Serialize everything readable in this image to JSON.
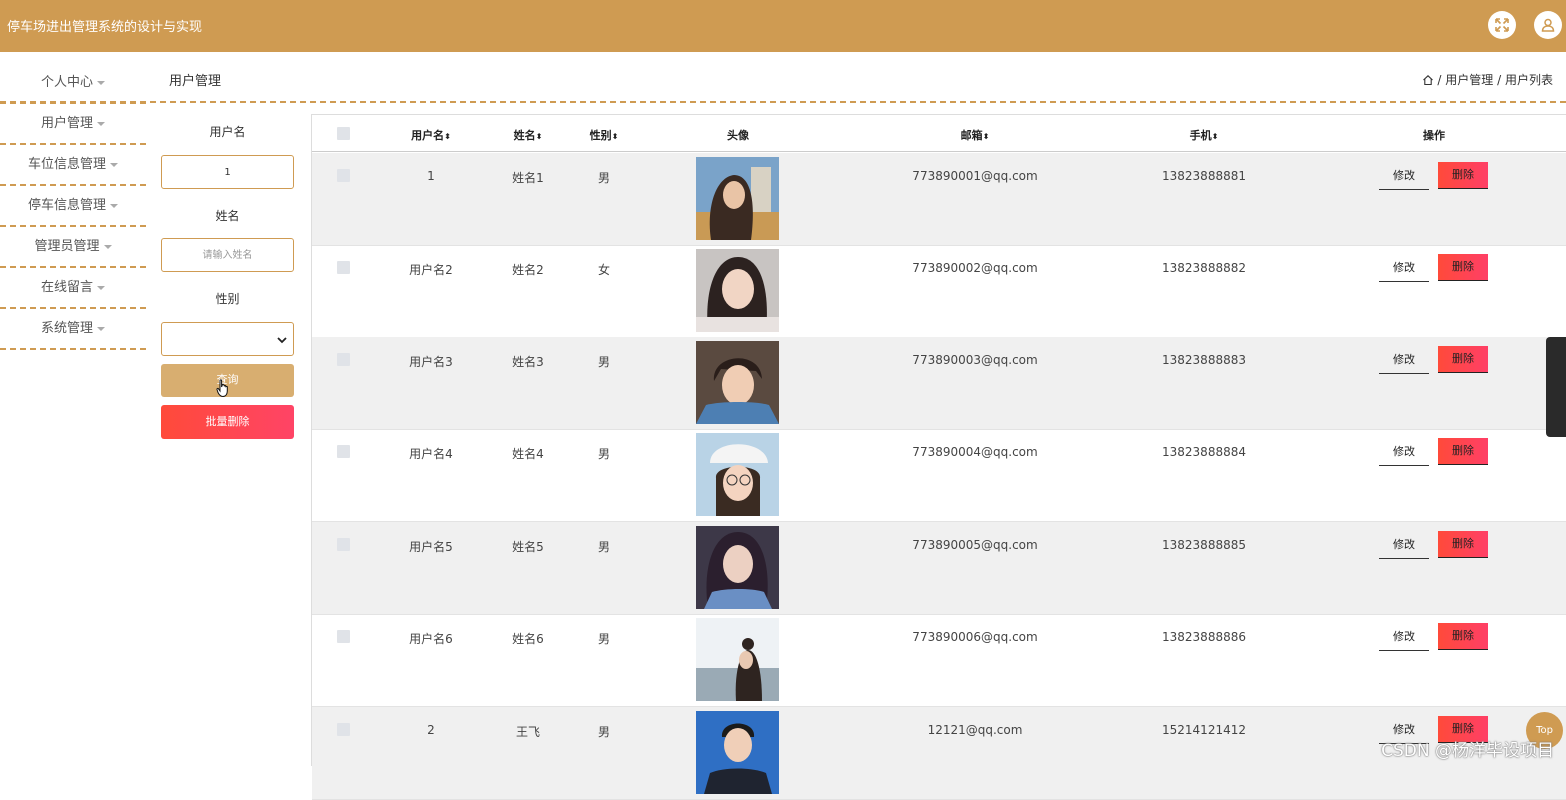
{
  "app": {
    "title": "停车场进出管理系统的设计与实现",
    "header_color": "#cf9b52"
  },
  "header": {
    "fullscreen_icon": "fullscreen-icon",
    "user_icon": "user-icon"
  },
  "sidebar": {
    "items": [
      {
        "label": "个人中心"
      },
      {
        "label": "用户管理"
      },
      {
        "label": "车位信息管理"
      },
      {
        "label": "停车信息管理"
      },
      {
        "label": "管理员管理"
      },
      {
        "label": "在线留言"
      },
      {
        "label": "系统管理"
      }
    ]
  },
  "page": {
    "title": "用户管理"
  },
  "breadcrumb": {
    "home_icon": "home-icon",
    "separator": "/",
    "items": [
      "用户管理",
      "用户列表"
    ]
  },
  "filter": {
    "username_label": "用户名",
    "username_value": "1",
    "name_label": "姓名",
    "name_placeholder": "请输入姓名",
    "gender_label": "性别",
    "gender_value": "",
    "query_button": "查询",
    "batch_delete_button": "批量删除"
  },
  "table": {
    "columns": [
      "用户名",
      "姓名",
      "性别",
      "头像",
      "邮箱",
      "手机",
      "操作"
    ],
    "sort_glyph": "⬍",
    "edit_label": "修改",
    "delete_label": "删除",
    "rows": [
      {
        "username": "1",
        "name": "姓名1",
        "gender": "男",
        "email": "773890001@qq.com",
        "phone": "13823888881"
      },
      {
        "username": "用户名2",
        "name": "姓名2",
        "gender": "女",
        "email": "773890002@qq.com",
        "phone": "13823888882"
      },
      {
        "username": "用户名3",
        "name": "姓名3",
        "gender": "男",
        "email": "773890003@qq.com",
        "phone": "13823888883"
      },
      {
        "username": "用户名4",
        "name": "姓名4",
        "gender": "男",
        "email": "773890004@qq.com",
        "phone": "13823888884"
      },
      {
        "username": "用户名5",
        "name": "姓名5",
        "gender": "男",
        "email": "773890005@qq.com",
        "phone": "13823888885"
      },
      {
        "username": "用户名6",
        "name": "姓名6",
        "gender": "男",
        "email": "773890006@qq.com",
        "phone": "13823888886"
      },
      {
        "username": "2",
        "name": "王飞",
        "gender": "男",
        "email": "12121@qq.com",
        "phone": "15214121412"
      }
    ]
  },
  "back_to_top": "Top",
  "watermark": "CSDN @杨洋毕设项目"
}
